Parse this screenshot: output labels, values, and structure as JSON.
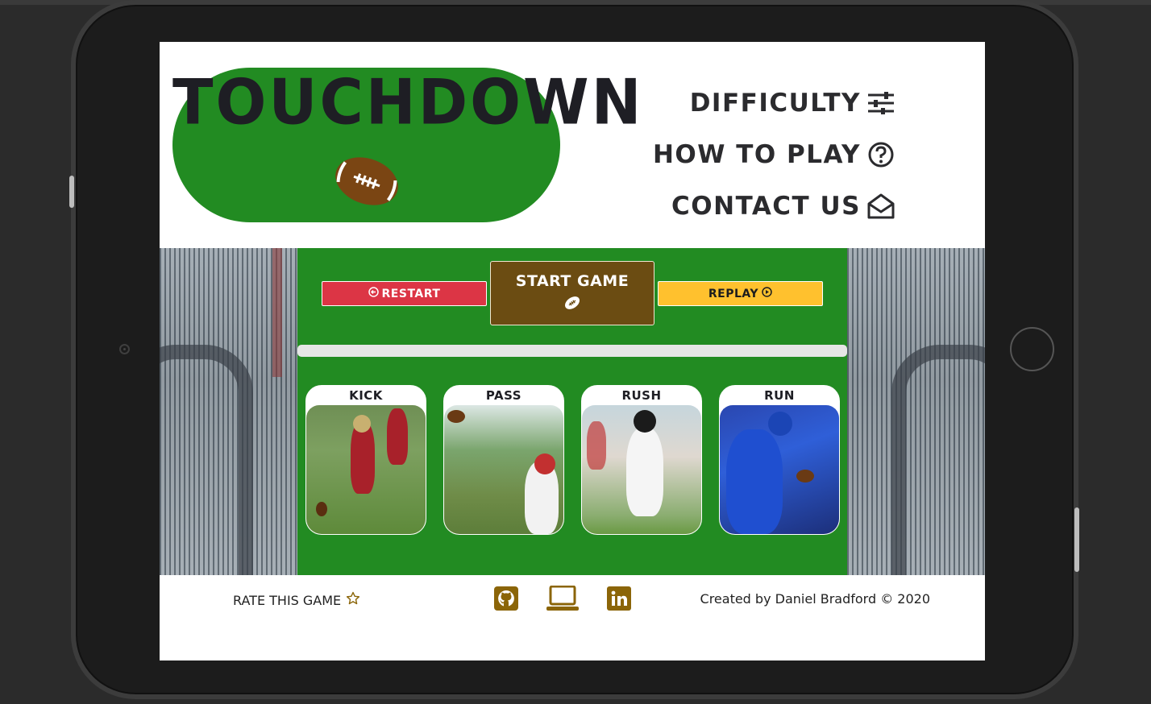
{
  "header": {
    "title": "TOUCHDOWN",
    "nav": [
      {
        "label": "DIFFICULTY",
        "icon": "sliders-icon"
      },
      {
        "label": "HOW TO PLAY",
        "icon": "question-circle-icon"
      },
      {
        "label": "CONTACT US",
        "icon": "envelope-open-icon"
      }
    ]
  },
  "controls": {
    "restart_label": "RESTART",
    "start_label": "START GAME",
    "replay_label": "REPLAY"
  },
  "plays": [
    {
      "label": "KICK"
    },
    {
      "label": "PASS"
    },
    {
      "label": "RUSH"
    },
    {
      "label": "RUN"
    }
  ],
  "footer": {
    "rate_label": "RATE THIS GAME",
    "credit": "Created by Daniel Bradford © 2020",
    "socials": [
      "github-icon",
      "laptop-icon",
      "linkedin-icon"
    ]
  },
  "colors": {
    "field_green": "#228b22",
    "restart_red": "#dc3545",
    "start_brown": "#6b4c12",
    "replay_yellow": "#ffc12e",
    "social_brown": "#8b6508"
  }
}
